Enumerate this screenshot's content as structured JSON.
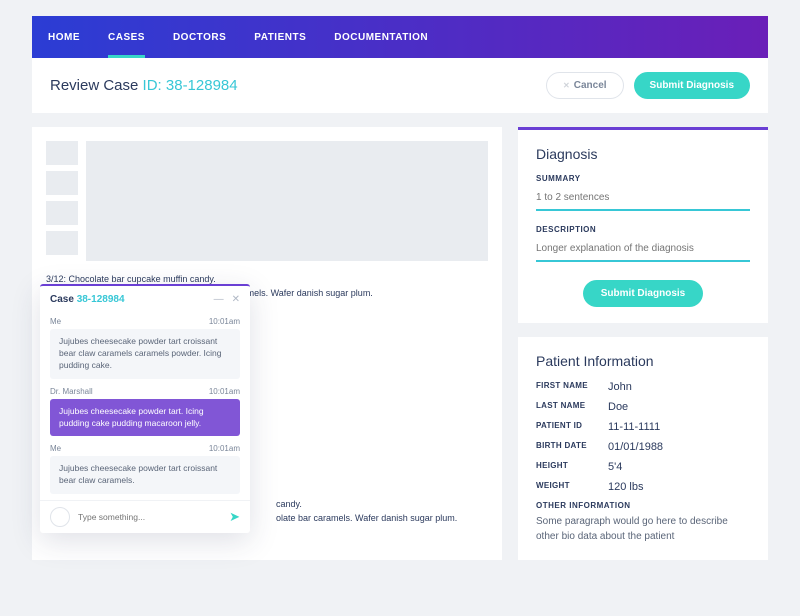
{
  "nav": {
    "items": [
      "HOME",
      "CASES",
      "DOCTORS",
      "PATIENTS",
      "DOCUMENTATION"
    ],
    "active_index": 1
  },
  "header": {
    "title_prefix": "Review Case ",
    "case_id": "ID: 38-128984",
    "cancel": "Cancel",
    "submit": "Submit Diagnosis"
  },
  "gallery_caption": "3/12: Chocolate bar cupcake muffin candy.\nPie jelly beans tiramisu dessert chocolate bar caramels. Wafer danish sugar plum.",
  "gallery_caption2": "candy.\nolate bar caramels. Wafer danish sugar plum.",
  "diagnosis": {
    "title": "Diagnosis",
    "summary_label": "SUMMARY",
    "summary_ph": "1 to 2 sentences",
    "desc_label": "DESCRIPTION",
    "desc_ph": "Longer explanation of the diagnosis",
    "submit": "Submit Diagnosis"
  },
  "patient": {
    "title": "Patient Information",
    "rows": [
      {
        "label": "FIRST NAME",
        "value": "John"
      },
      {
        "label": "LAST NAME",
        "value": "Doe"
      },
      {
        "label": "PATIENT ID",
        "value": "11-11-1111"
      },
      {
        "label": "BIRTH DATE",
        "value": "01/01/1988"
      },
      {
        "label": "HEIGHT",
        "value": "5'4"
      },
      {
        "label": "WEIGHT",
        "value": "120 lbs"
      }
    ],
    "other_label": "OTHER INFORMATION",
    "other_text": "Some paragraph would go here to describe other bio data about the patient"
  },
  "chat": {
    "title_prefix": "Case ",
    "case_id": "38-128984",
    "messages": [
      {
        "sender": "Me",
        "time": "10:01am",
        "text": "Jujubes cheesecake powder tart croissant bear claw caramels caramels powder. Icing pudding cake.",
        "mine": false
      },
      {
        "sender": "Dr. Marshall",
        "time": "10:01am",
        "text": "Jujubes cheesecake powder tart. Icing pudding cake pudding macaroon jelly.",
        "mine": true
      },
      {
        "sender": "Me",
        "time": "10:01am",
        "text": "Jujubes cheesecake powder tart croissant bear claw caramels.",
        "mine": false
      }
    ],
    "input_ph": "Type something..."
  }
}
